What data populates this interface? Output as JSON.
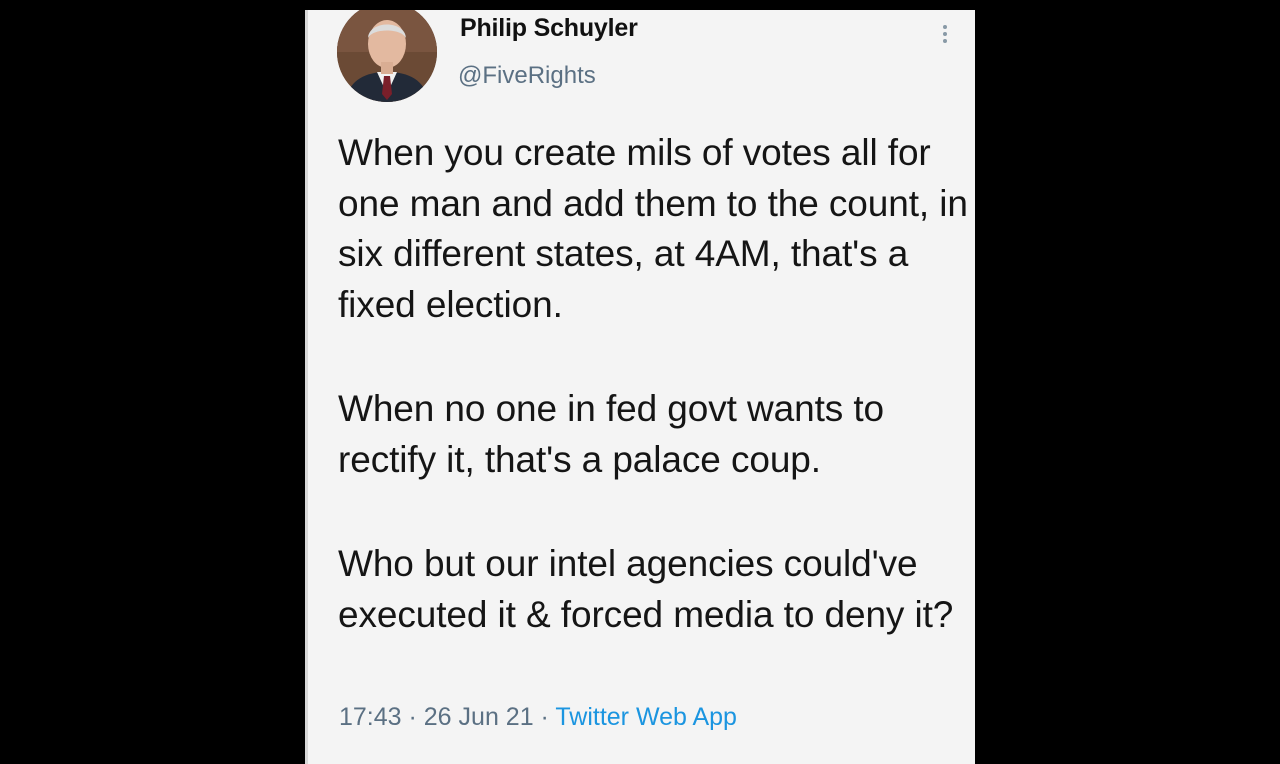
{
  "tweet": {
    "author_name": "Philip Schuyler",
    "author_handle": "@FiveRights",
    "paragraphs": [
      "When you create mils of votes all for one man and add them to the count, in six different states, at 4AM, that's a fixed election.",
      "When no one in fed govt wants to rectify it, that's a palace coup.",
      "Who but our intel agencies could've executed it & forced media to deny it?"
    ],
    "time": "17:43",
    "separator": " · ",
    "date": "26 Jun 21",
    "source": "Twitter Web App",
    "more_icon": "vertical-dots-icon"
  },
  "colors": {
    "card_background": "#f4f4f4",
    "page_background": "#000000",
    "text": "#151515",
    "muted": "#5b7083",
    "link": "#1b95e0"
  }
}
